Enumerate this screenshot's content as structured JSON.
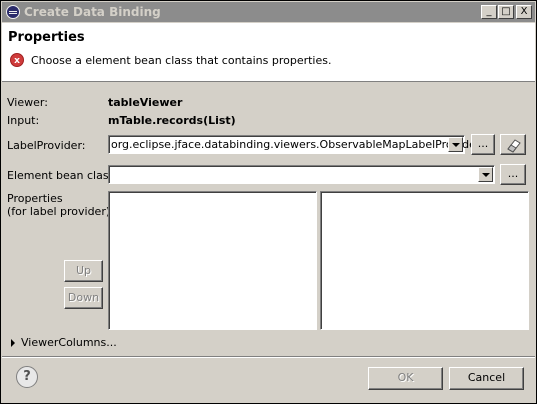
{
  "window": {
    "title": "Create Data Binding",
    "minimize": "_",
    "maximize": "□",
    "close": "X"
  },
  "header": {
    "title": "Properties",
    "error_icon": "x",
    "message": "Choose a element bean class that contains properties."
  },
  "form": {
    "viewer_label": "Viewer:",
    "viewer_value": "tableViewer",
    "input_label": "Input:",
    "input_value": "mTable.records(List)",
    "labelprovider_label": "LabelProvider:",
    "labelprovider_value": "org.eclipse.jface.databinding.viewers.ObservableMapLabelProvider",
    "labelprovider_browse": "...",
    "bean_label": "Element bean class:",
    "bean_value": "",
    "bean_browse": "...",
    "properties_label": "Properties",
    "properties_sublabel": "(for label provider):",
    "up_label": "Up",
    "down_label": "Down",
    "viewer_columns": "ViewerColumns..."
  },
  "footer": {
    "help": "?",
    "ok": "OK",
    "cancel": "Cancel"
  }
}
